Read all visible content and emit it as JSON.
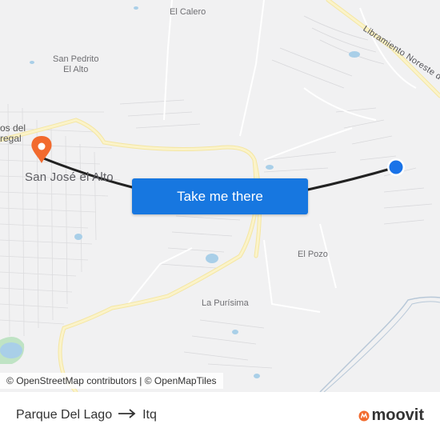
{
  "map": {
    "places": {
      "el_calero": "El Calero",
      "san_pedrito": "San Pedrito\nEl Alto",
      "ojos_del_cut_1": "os del",
      "ojos_del_cut_2": "regal",
      "san_jose": "San José el Alto",
      "el_pozo": "El Pozo",
      "la_purisima": "La Purísima",
      "libramiento": "Libramiento Noreste de Qu"
    },
    "cta_label": "Take me there",
    "attribution": {
      "prefix": "© ",
      "osm": "OpenStreetMap contributors",
      "separator": " | © ",
      "omt": "OpenMapTiles"
    },
    "colors": {
      "origin_pin": "#f26a2e",
      "destination_dot": "#1a73e8",
      "route_line": "#222222",
      "major_road": "#fbf0b5",
      "cta": "#1777e0"
    }
  },
  "footer": {
    "origin": "Parque Del Lago",
    "destination": "Itq",
    "brand": "moovit",
    "arrow_icon": "arrow-right-icon"
  }
}
